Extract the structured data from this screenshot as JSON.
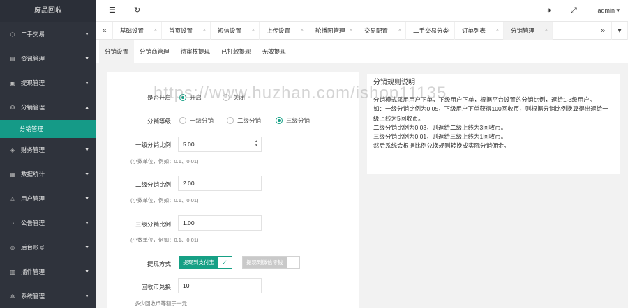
{
  "sidebar": {
    "brand": "废品回收",
    "items": [
      {
        "label": "二手交易",
        "icon": "box-icon",
        "glyph": "⬡",
        "caret": "▼"
      },
      {
        "label": "资讯管理",
        "icon": "document-icon",
        "glyph": "▤",
        "caret": "▼"
      },
      {
        "label": "提现管理",
        "icon": "wallet-icon",
        "glyph": "▣",
        "caret": "▼"
      },
      {
        "label": "分销管理",
        "icon": "share-icon",
        "glyph": "☊",
        "caret": "▲"
      },
      {
        "label": "财务管理",
        "icon": "finance-icon",
        "glyph": "◈",
        "caret": "▼"
      },
      {
        "label": "数据统计",
        "icon": "chart-icon",
        "glyph": "▦",
        "caret": "▼"
      },
      {
        "label": "用户管理",
        "icon": "user-icon",
        "glyph": "♙",
        "caret": "▼"
      },
      {
        "label": "公告管理",
        "icon": "bell-icon",
        "glyph": "◔",
        "caret": "▼"
      },
      {
        "label": "后台账号",
        "icon": "account-icon",
        "glyph": "◎",
        "caret": "▼"
      },
      {
        "label": "插件管理",
        "icon": "plugin-icon",
        "glyph": "▥",
        "caret": "▼"
      },
      {
        "label": "系统管理",
        "icon": "gear-icon",
        "glyph": "✲",
        "caret": "▼"
      }
    ],
    "active_sub": "分销管理"
  },
  "topbar": {
    "menu_glyph": "☰",
    "refresh_glyph": "↻",
    "theme_glyph": "◑",
    "fullscreen_glyph": "⤢",
    "user": "admin",
    "user_caret": "▾"
  },
  "tabs": {
    "prev_glyph": "«",
    "next_glyph": "»",
    "close_glyph": "×",
    "list": [
      "基础设置",
      "首页设置",
      "短信设置",
      "上传设置",
      "轮播图管理",
      "交易配置",
      "二手交易分类",
      "订单列表",
      "分销管理"
    ],
    "active": 8
  },
  "subtabs": {
    "list": [
      "分销设置",
      "分销商管理",
      "待审核提现",
      "已打款提现",
      "无效提现"
    ],
    "active": 0
  },
  "form": {
    "enable_label": "是否开启",
    "enable_on": "开启",
    "enable_off": "关闭",
    "level_label": "分销等级",
    "level_1": "一级分销",
    "level_2": "二级分销",
    "level_3": "三级分销",
    "ratio1_label": "一级分销比例",
    "ratio1_value": "5.00",
    "ratio2_label": "二级分销比例",
    "ratio2_value": "2.00",
    "ratio3_label": "三级分销比例",
    "ratio3_value": "1.00",
    "ratio_hint": "(小数单位，例如：0.1、0.01)",
    "spin_up": "▲",
    "spin_down": "▼",
    "withdraw_label": "提现方式",
    "withdraw_alipay": "提现到支付宝",
    "withdraw_check": "✓",
    "withdraw_wechat": "提现到微信零钱",
    "exchange_label": "回收币兑换",
    "exchange_value": "10",
    "exchange_hint": "多少回收币等额于一元"
  },
  "rules": {
    "title": "分销规则说明",
    "lines": [
      "分销模式采用用户下单，下级用户下单，根据平台设置的分销比例，返给1-3级用户。",
      "如：一级分销比例为0.05，下级用户下单获得100回收币，则根据分销比例换算得出返给一级上线为5回收币。",
      "二级分销比例为0.03，则返给二级上线为3回收币。",
      "三级分销比例为0.01，则返给三级上线为1回收币。",
      "然后系统会根据比例兑换规则转换成实际分销佣金。"
    ]
  },
  "watermark": "https://www.huzhan.com/ishop11135"
}
